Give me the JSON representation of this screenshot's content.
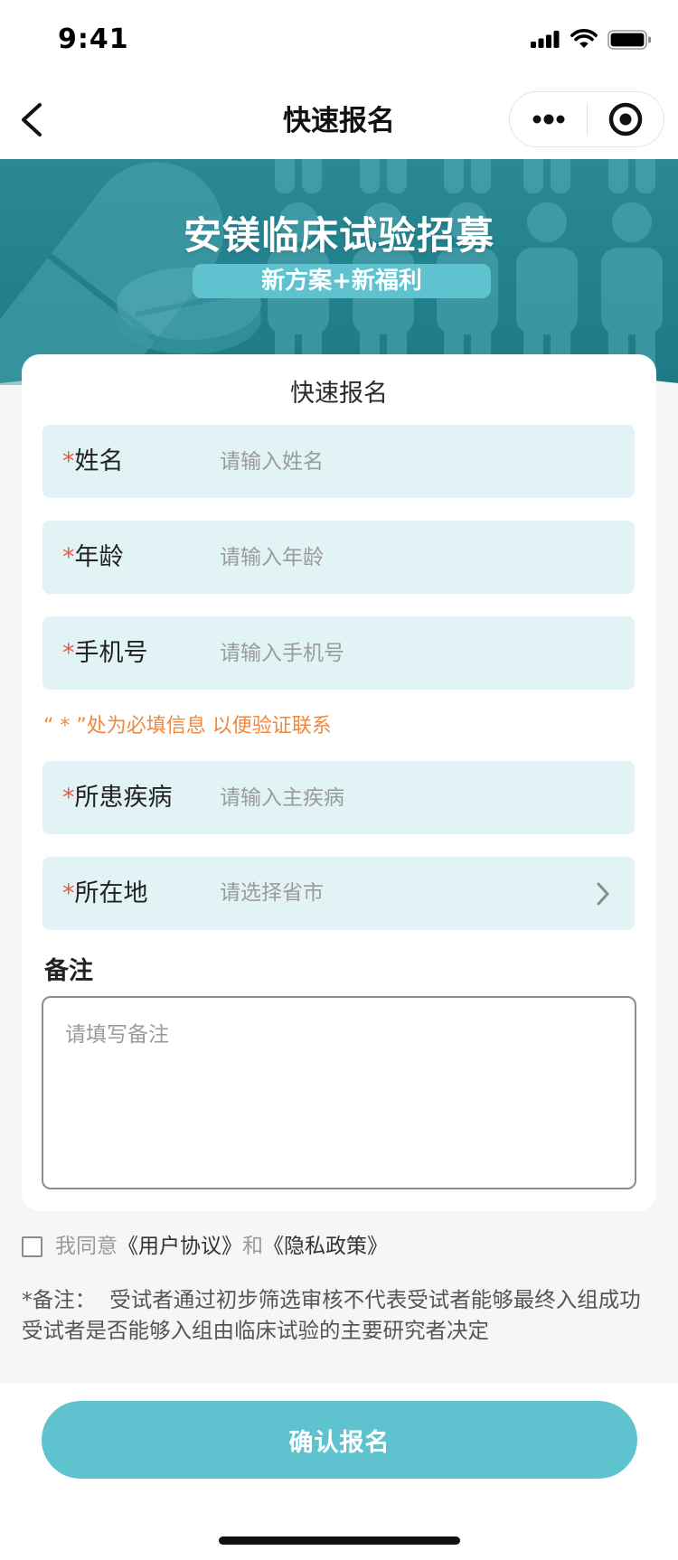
{
  "status_bar": {
    "time": "9:41"
  },
  "nav": {
    "title": "快速报名"
  },
  "banner": {
    "title": "安镁临床试验招募",
    "subtitle": "新方案+新福利"
  },
  "form": {
    "title": "快速报名",
    "required_mark": "*",
    "fields": [
      {
        "label": "姓名",
        "placeholder": "请输入姓名",
        "type": "text"
      },
      {
        "label": "年龄",
        "placeholder": "请输入年龄",
        "type": "text"
      },
      {
        "label": "手机号",
        "placeholder": "请输入手机号",
        "type": "text"
      },
      {
        "label": "所患疾病",
        "placeholder": "请输入主疾病",
        "type": "text"
      },
      {
        "label": "所在地",
        "placeholder": "请选择省市",
        "type": "picker"
      }
    ],
    "required_hint": "“ * ”处为必填信息 以便验证联系",
    "remark_label": "备注",
    "remark_placeholder": "请填写备注"
  },
  "agreement": {
    "checked": false,
    "prefix": "我同意",
    "user_agreement": "《用户协议》",
    "conjunction": "和",
    "privacy_policy": "《隐私政策》"
  },
  "note": {
    "line1": "*备注：  受试者通过初步筛选审核不代表受试者能够最终入组成功",
    "line2": "受试者是否能够入组由临床试验的主要研究者决定"
  },
  "submit": {
    "label": "确认报名"
  },
  "icons": {
    "back": "chevron-left-icon",
    "more": "more-dots-icon",
    "close": "target-icon",
    "location_picker": "chevron-right-icon",
    "agreement": "checkbox-icon"
  },
  "colors": {
    "accent": "#5fc3cf",
    "banner_top": "#2a8995",
    "banner_bottom": "#1d7a86",
    "field_bg": "#e2f3f6",
    "hint": "#f0883e",
    "required_mark": "#e8594a"
  }
}
